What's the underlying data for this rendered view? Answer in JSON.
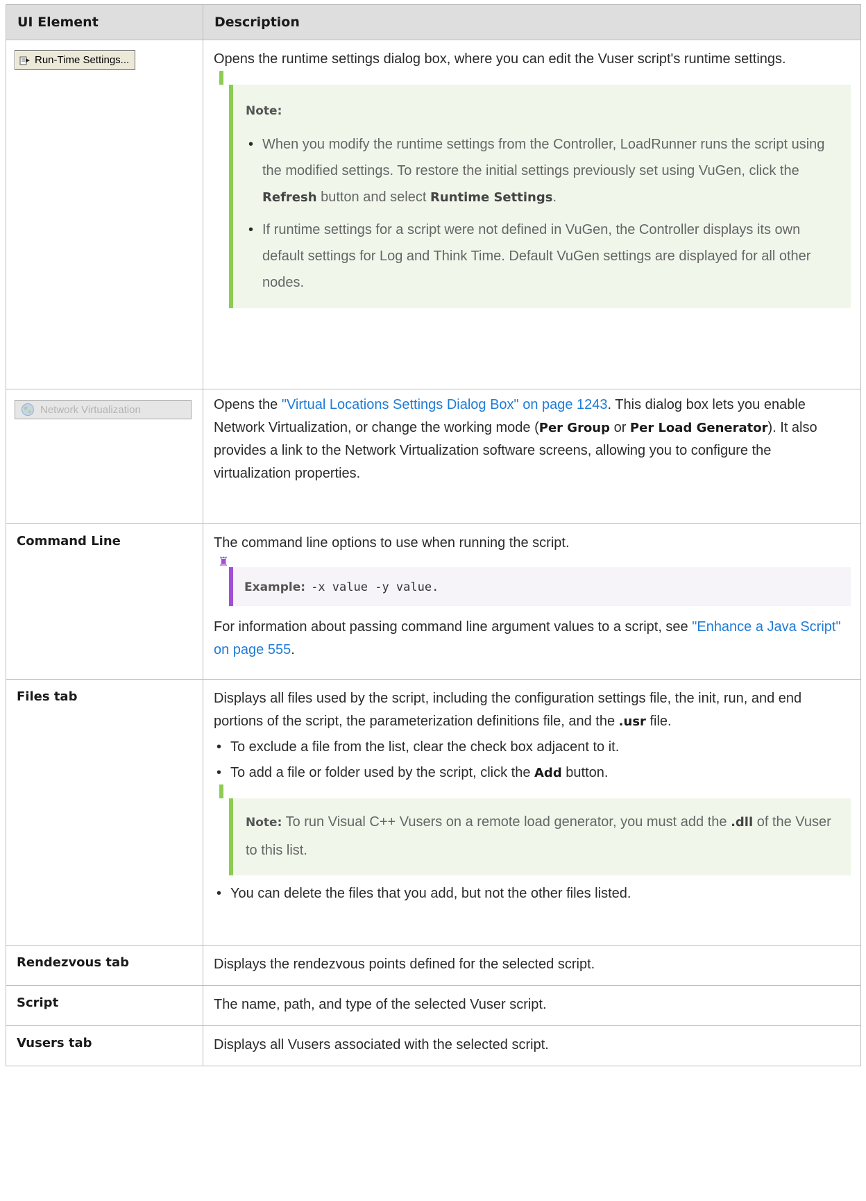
{
  "table": {
    "header": {
      "col1": "UI Element",
      "col2": "Description"
    },
    "rows": [
      {
        "button_label": "Run-Time Settings...",
        "icon": "settings-arrow-icon",
        "desc": "Opens the runtime settings dialog box, where you can edit the Vuser script's runtime settings.",
        "note": {
          "label": "Note:",
          "b1_a": "When you modify the runtime settings from the Controller, LoadRunner runs the script using the modified settings. To restore the initial settings previously set using VuGen, click the ",
          "b1_refresh": "Refresh",
          "b1_b": " button and select ",
          "b1_rts": "Runtime Settings",
          "b1_c": ".",
          "b2": "If runtime settings for a script were not defined in VuGen, the Controller displays its own default settings for Log and Think Time. Default VuGen settings are displayed for all other nodes."
        }
      },
      {
        "button_label": "Network Virtualization",
        "icon": "globe-icon",
        "d_a": "Opens the ",
        "d_link": "\"Virtual Locations Settings Dialog Box\" on page 1243",
        "d_b": ". This dialog box lets you enable Network Virtualization, or change the working mode (",
        "d_pg": "Per Group",
        "d_or": " or ",
        "d_plg": "Per Load Generator",
        "d_c": "). It also provides a link to the Network Virtualization software screens, allowing you to configure the virtualization properties."
      },
      {
        "element": "Command Line",
        "desc": "The command line options to use when running the script.",
        "example": {
          "label": "Example:",
          "code": "-x value -y value."
        },
        "d2_a": "For information about passing command line argument values to a script, see ",
        "d2_link": "\"Enhance a Java Script\" on page 555",
        "d2_b": "."
      },
      {
        "element": "Files tab",
        "d_a": "Displays all files used by the script, including the configuration settings file, the init, run, and end portions of the script, the parameterization definitions file, and the ",
        "d_usr": ".usr",
        "d_b": " file.",
        "b1": "To exclude a file from the list, clear the check box adjacent to it.",
        "b2_a": "To add a file or folder used by the script, click the ",
        "b2_add": "Add",
        "b2_b": " button.",
        "note": {
          "label": "Note:",
          "a": " To run Visual C++ Vusers on a remote load generator, you must add the ",
          "dll": ".dll",
          "b": " of the Vuser to this list."
        },
        "b3": "You can delete the files that you add, but not the other files listed."
      },
      {
        "element": "Rendezvous tab",
        "desc": "Displays the rendezvous points defined for the selected script."
      },
      {
        "element": "Script",
        "desc": "The name, path, and type of the selected Vuser script."
      },
      {
        "element": "Vusers tab",
        "desc": "Displays all Vusers associated with the selected script."
      }
    ]
  }
}
